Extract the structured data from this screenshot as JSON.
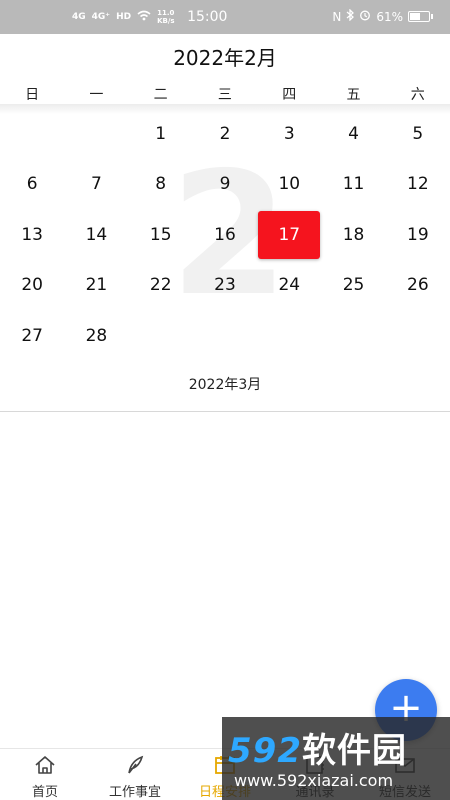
{
  "status_bar": {
    "net1": "4G",
    "net2": "4G⁺",
    "hd": "HD",
    "speed": "11.0 KB/s",
    "time": "15:00",
    "nfc": "N",
    "battery_text": "61%",
    "battery_level": 0.61
  },
  "calendar": {
    "month_title": "2022年2月",
    "weekdays": [
      "日",
      "一",
      "二",
      "三",
      "四",
      "五",
      "六"
    ],
    "watermark_digit": "2",
    "selected_day": 17,
    "rows": [
      [
        "",
        "",
        "1",
        "2",
        "3",
        "4",
        "5"
      ],
      [
        "6",
        "7",
        "8",
        "9",
        "10",
        "11",
        "12"
      ],
      [
        "13",
        "14",
        "15",
        "16",
        "17",
        "18",
        "19"
      ],
      [
        "20",
        "21",
        "22",
        "23",
        "24",
        "25",
        "26"
      ],
      [
        "27",
        "28",
        "",
        "",
        "",
        "",
        ""
      ]
    ],
    "next_month_label": "2022年3月"
  },
  "fab": {
    "label": "+"
  },
  "bottom_nav": {
    "items": [
      {
        "label": "首页",
        "icon": "home-icon",
        "active": false
      },
      {
        "label": "工作事宜",
        "icon": "feather-icon",
        "active": false
      },
      {
        "label": "日程安排",
        "icon": "calendar-icon",
        "active": true
      },
      {
        "label": "通讯录",
        "icon": "contacts-icon",
        "active": false
      },
      {
        "label": "短信发送",
        "icon": "mail-icon",
        "active": false
      }
    ]
  },
  "watermark_banner": {
    "brand_num": "592",
    "brand_text": "软件园",
    "url": "www.592xiazai.com"
  },
  "colors": {
    "selected_day": "#f5141e",
    "fab": "#3c7cf0",
    "active_nav": "#e6a800"
  }
}
